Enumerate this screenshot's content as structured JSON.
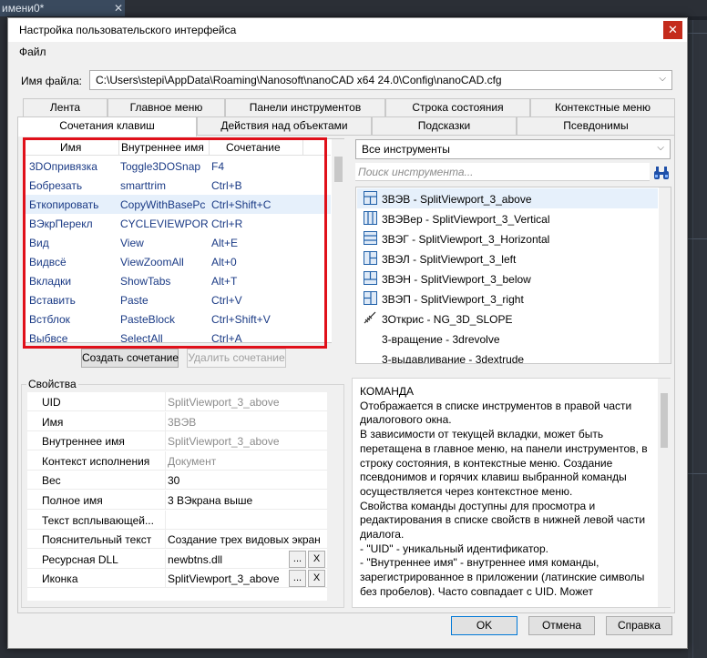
{
  "background": {
    "tab_title": "имени0*",
    "tab_close": "✕"
  },
  "dialog": {
    "title": "Настройка пользовательского интерфейса",
    "close_glyph": "✕",
    "menu": {
      "file": "Файл"
    },
    "filename_label": "Имя файла:",
    "filename_value": "C:\\Users\\stepi\\AppData\\Roaming\\Nanosoft\\nanoCAD x64 24.0\\Config\\nanoCAD.cfg",
    "tabs_row1": [
      "Лента",
      "Главное меню",
      "Панели инструментов",
      "Строка состояния",
      "Контекстные меню"
    ],
    "tabs_row2": [
      "Сочетания клавиш",
      "Действия над объектами",
      "Подсказки",
      "Псевдонимы"
    ],
    "active_tab": "Сочетания клавиш"
  },
  "hotkeys": {
    "columns": [
      "Имя",
      "Внутреннее имя",
      "Сочетание"
    ],
    "rows": [
      [
        "3DОпривязка",
        "Toggle3DOSnap",
        "F4"
      ],
      [
        "Бобрезать",
        "smarttrim",
        "Ctrl+B"
      ],
      [
        "Бткопировать",
        "CopyWithBasePc",
        "Ctrl+Shift+C"
      ],
      [
        "ВЭкрПерекл",
        "CYCLEVIEWPORT",
        "Ctrl+R"
      ],
      [
        "Вид",
        "View",
        "Alt+E"
      ],
      [
        "Видвсё",
        "ViewZoomAll",
        "Alt+0"
      ],
      [
        "Вкладки",
        "ShowTabs",
        "Alt+T"
      ],
      [
        "Вставить",
        "Paste",
        "Ctrl+V"
      ],
      [
        "Встблок",
        "PasteBlock",
        "Ctrl+Shift+V"
      ],
      [
        "Выбвсе",
        "SelectAll",
        "Ctrl+A"
      ]
    ],
    "selected_index": 2,
    "create_button": "Создать сочетание",
    "delete_button": "Удалить сочетание"
  },
  "tools": {
    "filter_value": "Все инструменты",
    "search_placeholder": "Поиск инструмента...",
    "items": [
      {
        "label": "3ВЭВ - SplitViewport_3_above",
        "icon": "viewport-above-icon"
      },
      {
        "label": "3ВЭВер - SplitViewport_3_Vertical",
        "icon": "viewport-vertical-icon"
      },
      {
        "label": "3ВЭГ - SplitViewport_3_Horizontal",
        "icon": "viewport-horizontal-icon"
      },
      {
        "label": "3ВЭЛ - SplitViewport_3_left",
        "icon": "viewport-left-icon"
      },
      {
        "label": "3ВЭН - SplitViewport_3_below",
        "icon": "viewport-below-icon"
      },
      {
        "label": "3ВЭП - SplitViewport_3_right",
        "icon": "viewport-right-icon"
      },
      {
        "label": "3Открис - NG_3D_SLOPE",
        "icon": "slope-icon"
      },
      {
        "label": "3-вращение - 3drevolve",
        "icon": ""
      },
      {
        "label": "3-выдавливание - 3dextrude",
        "icon": ""
      }
    ],
    "selected_index": 0
  },
  "properties": {
    "legend": "Свойства",
    "rows": [
      {
        "name": "UID",
        "value": "SplitViewport_3_above",
        "gray": true
      },
      {
        "name": "Имя",
        "value": "3ВЭВ",
        "gray": true
      },
      {
        "name": "Внутреннее имя",
        "value": "SplitViewport_3_above",
        "gray": true
      },
      {
        "name": "Контекст исполнения",
        "value": "Документ",
        "gray": true
      },
      {
        "name": "Вес",
        "value": "30",
        "gray": false
      },
      {
        "name": "Полное имя",
        "value": "3 ВЭкрана выше",
        "gray": false
      },
      {
        "name": "Текст всплывающей...",
        "value": "",
        "gray": false
      },
      {
        "name": "Пояснительный текст",
        "value": "Создание трех видовых экран",
        "gray": false
      },
      {
        "name": "Ресурсная DLL",
        "value": "newbtns.dll",
        "gray": false
      },
      {
        "name": "Иконка",
        "value": "SplitViewport_3_above",
        "gray": false
      }
    ],
    "browse_glyph": "...",
    "clear_glyph": "X"
  },
  "description": {
    "lines": [
      "КОМАНДА",
      "Отображается в списке инструментов в правой части диалогового окна.",
      "В зависимости от текущей вкладки, может быть перетащена в главное меню, на панели инструментов, в строку состояния, в контекстные меню. Создание псевдонимов и горячих клавиш выбранной команды осуществляется через контекстное меню.",
      "Свойства команды доступны для просмотра и редактирования в списке свойств в нижней левой части диалога.",
      " - \"UID\" - уникальный идентификатор.",
      " - \"Внутреннее имя\" - внутреннее имя команды, зарегистрированное в приложении (латинские символы без пробелов). Часто совпадает с UID. Может"
    ]
  },
  "footer": {
    "ok": "OK",
    "cancel": "Отмена",
    "help": "Справка"
  }
}
